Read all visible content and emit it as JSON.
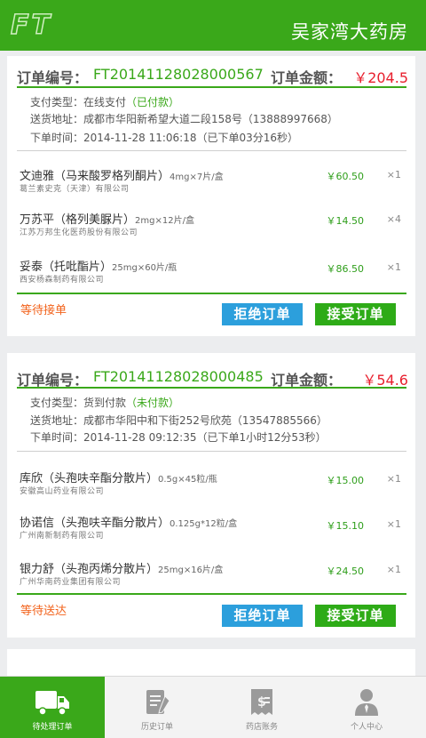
{
  "header": {
    "logo": "FT",
    "title": "吴家湾大药房"
  },
  "labels": {
    "order_no": "订单编号：",
    "order_amount": "订单金额：",
    "pay_type": "支付类型：",
    "address": "送货地址：",
    "order_time": "下单时间："
  },
  "orders": [
    {
      "number": "FT20141128028000567",
      "amount": "￥204.5",
      "pay_type": "在线支付",
      "pay_status": "（已付款）",
      "address": "成都市华阳新希望大道二段158号（13888997668）",
      "time": "2014-11-28 11:06:18（已下单03分16秒）",
      "items": [
        {
          "name": "文迪雅（马来酸罗格列酮片）",
          "spec": "4mg×7片/盒",
          "maker": "葛兰素史克（天津）有限公司",
          "price": "￥60.50",
          "qty": "×1"
        },
        {
          "name": "万苏平（格列美脲片）",
          "spec": "2mg×12片/盒",
          "maker": "江苏万邦生化医药股份有限公司",
          "price": "￥14.50",
          "qty": "×4"
        },
        {
          "name": "妥泰（托吡酯片）",
          "spec": "25mg×60片/瓶",
          "maker": "西安杨森制药有限公司",
          "price": "￥86.50",
          "qty": "×1"
        }
      ],
      "status": "等待接单",
      "reject_label": "拒绝订单",
      "accept_label": "接受订单"
    },
    {
      "number": "FT20141128028000485",
      "amount": "￥54.6",
      "pay_type": "货到付款",
      "pay_status": "（未付款）",
      "address": "成都市华阳中和下街252号欣苑（13547885566）",
      "time": "2014-11-28 09:12:35（已下单1小时12分53秒）",
      "items": [
        {
          "name": "库欣（头孢呋辛酯分散片）",
          "spec": "0.5g×45粒/瓶",
          "maker": "安徽高山药业有限公司",
          "price": "￥15.00",
          "qty": "×1"
        },
        {
          "name": "协诺信（头孢呋辛酯分散片）",
          "spec": "0.125g*12粒/盒",
          "maker": "广州南新制药有限公司",
          "price": "￥15.10",
          "qty": "×1"
        },
        {
          "name": "银力舒（头孢丙烯分散片）",
          "spec": "25mg×16片/盒",
          "maker": "广州华南药业集团有限公司",
          "price": "￥24.50",
          "qty": "×1"
        }
      ],
      "status": "等待送达",
      "reject_label": "拒绝订单",
      "accept_label": "接受订单"
    }
  ],
  "tabs": [
    {
      "label": "待处理订单",
      "icon": "truck-icon",
      "active": true
    },
    {
      "label": "历史订单",
      "icon": "history-icon",
      "active": false
    },
    {
      "label": "药店账务",
      "icon": "bill-icon",
      "active": false
    },
    {
      "label": "个人中心",
      "icon": "user-icon",
      "active": false
    }
  ],
  "colors": {
    "primary_green": "#3aa81a",
    "price_red": "#e8202e",
    "reject_blue": "#2c9fdc",
    "accept_green": "#2eab17",
    "status_orange": "#f2631c"
  }
}
